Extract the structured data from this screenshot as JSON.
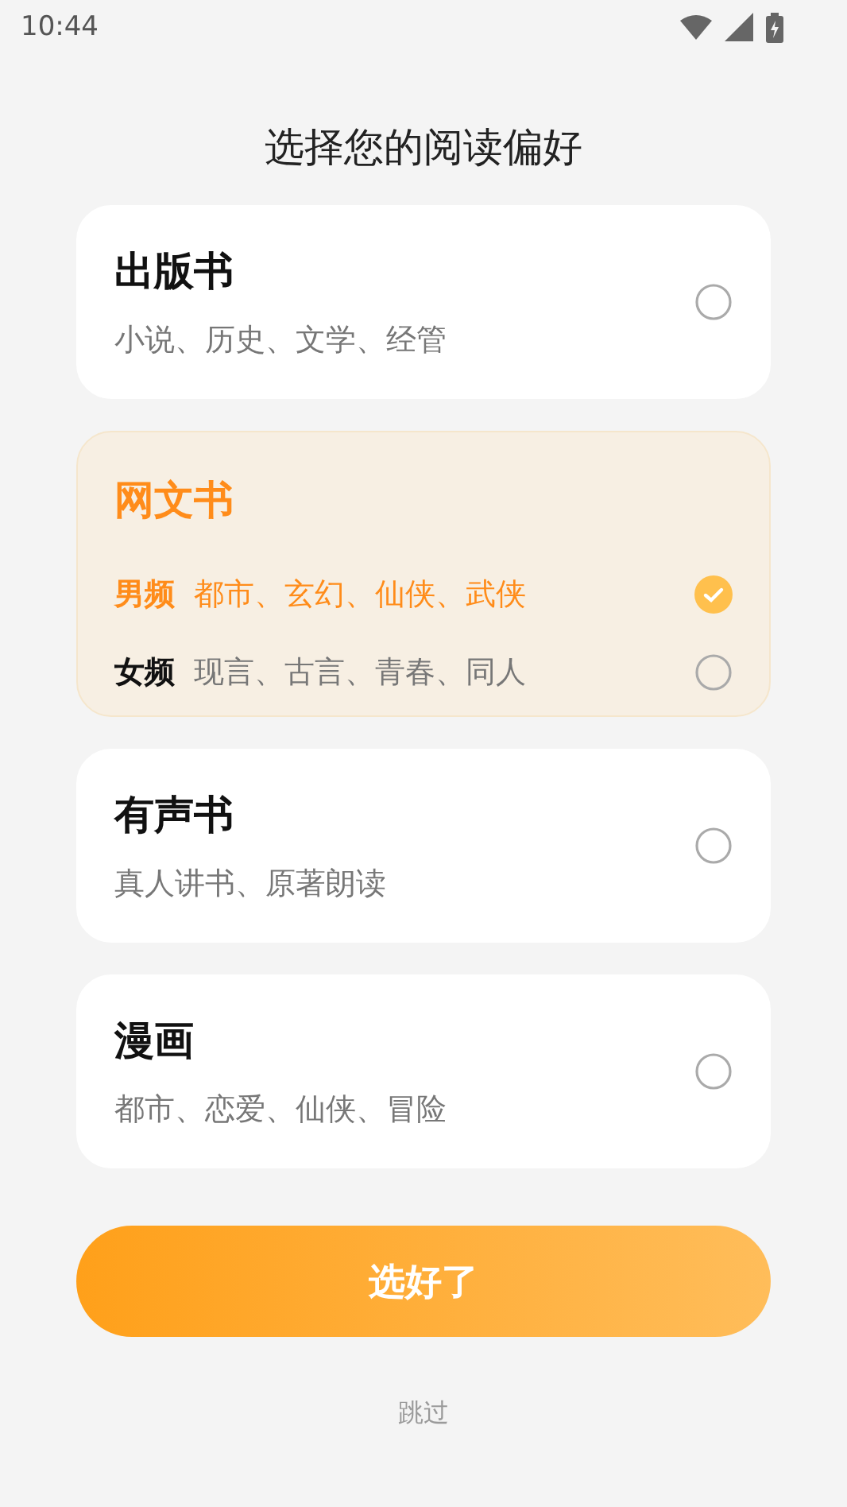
{
  "status_bar": {
    "time": "10:44"
  },
  "title": "选择您的阅读偏好",
  "cards": [
    {
      "kind": "simple",
      "title": "出版书",
      "subtitle": "小说、历史、文学、经管",
      "selected": false
    },
    {
      "kind": "split",
      "title": "网文书",
      "options": [
        {
          "label": "男频",
          "genres": "都市、玄幻、仙侠、武侠",
          "selected": true
        },
        {
          "label": "女频",
          "genres": "现言、古言、青春、同人",
          "selected": false
        }
      ]
    },
    {
      "kind": "simple",
      "title": "有声书",
      "subtitle": "真人讲书、原著朗读",
      "selected": false
    },
    {
      "kind": "simple",
      "title": "漫画",
      "subtitle": "都市、恋爱、仙侠、冒险",
      "selected": false
    }
  ],
  "confirm_button": "选好了",
  "skip_link": "跳过"
}
